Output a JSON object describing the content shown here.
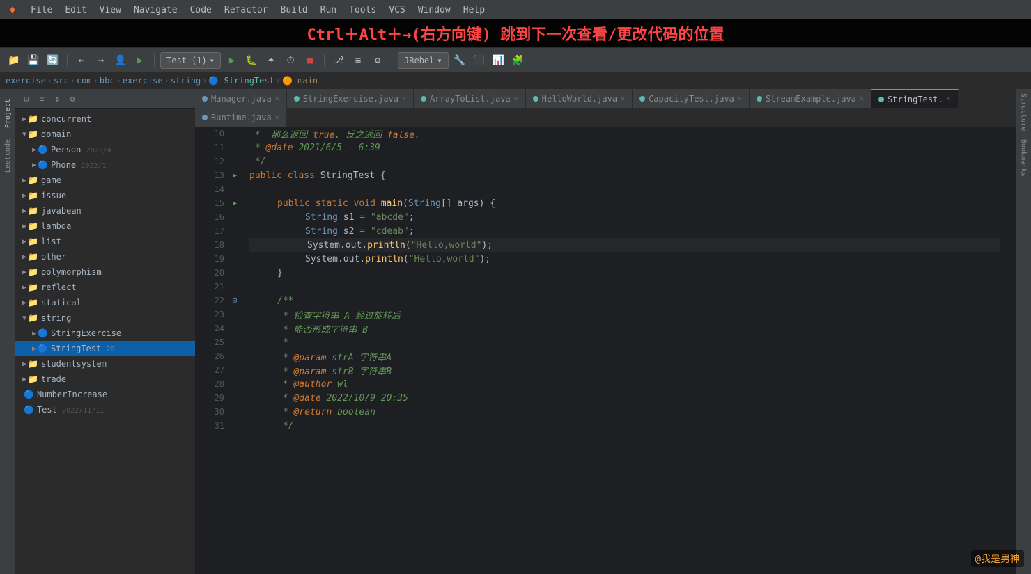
{
  "app": {
    "logo": "♦",
    "tooltip": "Ctrl＋Alt＋→(右方向键) 跳到下一次查看/更改代码的位置"
  },
  "menu": {
    "items": [
      "File",
      "Edit",
      "View",
      "Navigate",
      "Code",
      "Refactor",
      "Build",
      "Run",
      "Tools",
      "VCS",
      "Window",
      "Help"
    ]
  },
  "toolbar": {
    "config_label": "Test (1)",
    "jrebel_label": "JRebel"
  },
  "breadcrumb": {
    "items": [
      "exercise",
      "src",
      "com",
      "bbc",
      "exercise",
      "string",
      "StringTest",
      "main"
    ]
  },
  "tabs": {
    "row1": [
      {
        "label": "Manager.java",
        "type": "blue",
        "active": false
      },
      {
        "label": "StringExercise.java",
        "type": "teal",
        "active": false
      },
      {
        "label": "ArrayToList.java",
        "type": "teal",
        "active": false
      },
      {
        "label": "HelloWorld.java",
        "type": "teal",
        "active": false
      },
      {
        "label": "CapacityTest.java",
        "type": "teal",
        "active": false
      },
      {
        "label": "StreamExample.java",
        "type": "teal",
        "active": false
      },
      {
        "label": "StringTest.",
        "type": "teal",
        "active": true
      }
    ],
    "row2": [
      {
        "label": "Runtime.java",
        "type": "blue",
        "active": false
      }
    ]
  },
  "filetree": {
    "items": [
      {
        "level": 1,
        "type": "folder",
        "name": "concurrent",
        "expanded": false
      },
      {
        "level": 1,
        "type": "folder",
        "name": "domain",
        "expanded": true
      },
      {
        "level": 2,
        "type": "java",
        "name": "Person",
        "suffix": "2023/4",
        "expanded": false
      },
      {
        "level": 2,
        "type": "java",
        "name": "Phone",
        "suffix": "2022/1",
        "expanded": false
      },
      {
        "level": 1,
        "type": "folder",
        "name": "game",
        "expanded": false
      },
      {
        "level": 1,
        "type": "folder",
        "name": "issue",
        "expanded": false
      },
      {
        "level": 1,
        "type": "folder",
        "name": "javabean",
        "expanded": false
      },
      {
        "level": 1,
        "type": "folder",
        "name": "lambda",
        "expanded": false
      },
      {
        "level": 1,
        "type": "folder",
        "name": "list",
        "expanded": false
      },
      {
        "level": 1,
        "type": "folder",
        "name": "other",
        "expanded": false
      },
      {
        "level": 1,
        "type": "folder",
        "name": "polymorphism",
        "expanded": false
      },
      {
        "level": 1,
        "type": "folder",
        "name": "reflect",
        "expanded": false
      },
      {
        "level": 1,
        "type": "folder",
        "name": "statical",
        "expanded": false
      },
      {
        "level": 1,
        "type": "folder",
        "name": "string",
        "expanded": true
      },
      {
        "level": 2,
        "type": "java",
        "name": "StringExercise",
        "suffix": "",
        "expanded": false
      },
      {
        "level": 2,
        "type": "java",
        "name": "StringTest",
        "suffix": "20",
        "selected": true,
        "expanded": false
      },
      {
        "level": 1,
        "type": "folder",
        "name": "studentsystem",
        "expanded": false
      },
      {
        "level": 1,
        "type": "folder",
        "name": "trade",
        "expanded": false
      },
      {
        "level": 1,
        "type": "java",
        "name": "NumberIncrease",
        "suffix": "",
        "expanded": false
      },
      {
        "level": 1,
        "type": "java",
        "name": "Test",
        "suffix": "2022/11/11",
        "expanded": false
      }
    ]
  },
  "code": {
    "lines": [
      {
        "num": 10,
        "content": " *  那么返回 true. 反之返回 false.",
        "type": "comment"
      },
      {
        "num": 11,
        "content": " * @date 2021/6/5 - 6:39",
        "type": "comment"
      },
      {
        "num": 12,
        "content": " */",
        "type": "comment"
      },
      {
        "num": 13,
        "content": "public class StringTest {",
        "type": "class",
        "runnable": true
      },
      {
        "num": 14,
        "content": "",
        "type": "empty"
      },
      {
        "num": 15,
        "content": "    public static void main(String[] args) {",
        "type": "method",
        "runnable": true
      },
      {
        "num": 16,
        "content": "        String s1 = \"abcde\";",
        "type": "code"
      },
      {
        "num": 17,
        "content": "        String s2 = \"cdeab\";",
        "type": "code"
      },
      {
        "num": 18,
        "content": "        System.out.println(\"Hello,world\");",
        "type": "code",
        "current": true
      },
      {
        "num": 19,
        "content": "        System.out.println(\"Hello,world\");",
        "type": "code"
      },
      {
        "num": 20,
        "content": "    }",
        "type": "code"
      },
      {
        "num": 21,
        "content": "",
        "type": "empty"
      },
      {
        "num": 22,
        "content": "    /**",
        "type": "comment",
        "foldable": true
      },
      {
        "num": 23,
        "content": "     * 检查字符串 A 经过旋转后",
        "type": "comment"
      },
      {
        "num": 24,
        "content": "     * 能否形成字符串 B",
        "type": "comment"
      },
      {
        "num": 25,
        "content": "     *",
        "type": "comment"
      },
      {
        "num": 26,
        "content": "     * @param strA 字符串A",
        "type": "comment"
      },
      {
        "num": 27,
        "content": "     * @param strB 字符串B",
        "type": "comment"
      },
      {
        "num": 28,
        "content": "     * @author wl",
        "type": "comment"
      },
      {
        "num": 29,
        "content": "     * @date 2022/10/9 20:35",
        "type": "comment"
      },
      {
        "num": 30,
        "content": "     * @return boolean",
        "type": "comment"
      },
      {
        "num": 31,
        "content": "     */",
        "type": "comment"
      }
    ]
  },
  "watermark": "@我是男神",
  "sidebar_left": {
    "tabs": [
      "Project",
      "Leetcode",
      "Structure",
      "Bookmarks"
    ]
  }
}
